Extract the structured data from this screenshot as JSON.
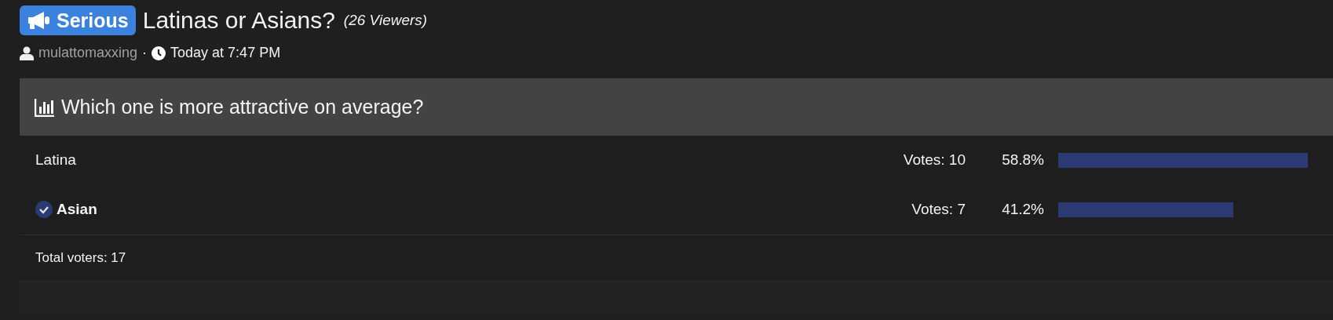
{
  "thread": {
    "prefix": "Serious",
    "title": "Latinas or Asians?",
    "viewers": "(26 Viewers)",
    "author": "mulattomaxxing",
    "separator": "·",
    "time": "Today at 7:47 PM"
  },
  "poll": {
    "question": "Which one is more attractive on average?",
    "options": [
      {
        "label": "Latina",
        "voted": false,
        "votes": "Votes: 10",
        "percent": "58.8%"
      },
      {
        "label": "Asian",
        "voted": true,
        "votes": "Votes: 7",
        "percent": "41.2%"
      }
    ],
    "total": "Total voters: 17"
  }
}
